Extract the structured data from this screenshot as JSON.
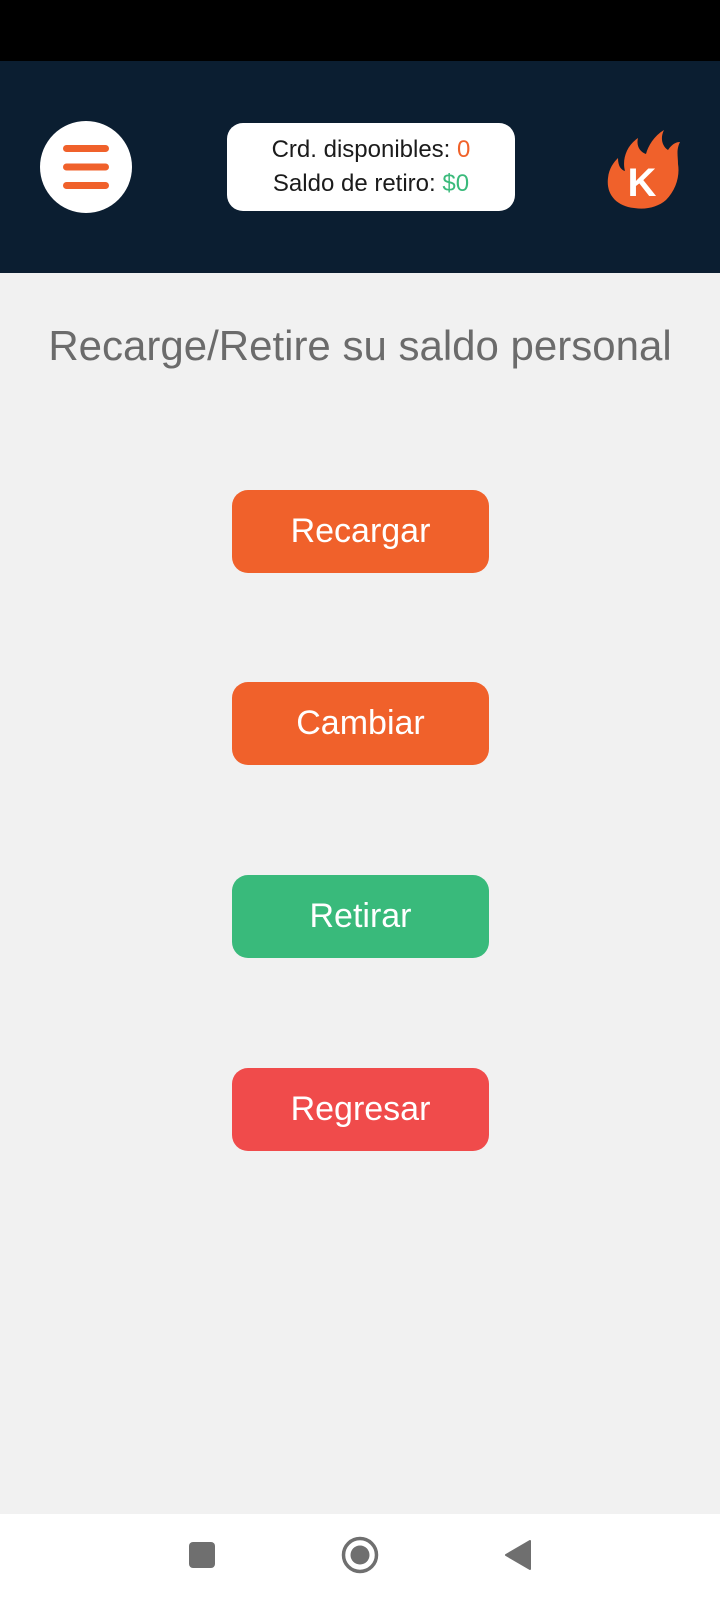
{
  "header": {
    "credits_label": "Crd. disponibles:",
    "credits_value": "0",
    "withdraw_label": "Saldo de retiro:",
    "withdraw_value": "$0",
    "logo_letter": "K"
  },
  "page": {
    "title": "Recarge/Retire su saldo personal"
  },
  "actions": {
    "recargar": "Recargar",
    "cambiar": "Cambiar",
    "retirar": "Retirar",
    "regresar": "Regresar"
  },
  "icons": {
    "menu": "hamburger-menu-icon",
    "logo": "flame-k-logo",
    "recents": "square-recents-icon",
    "home": "circle-home-icon",
    "back": "triangle-back-icon"
  },
  "colors": {
    "header_bg": "#0b1e31",
    "accent_orange": "#f0612b",
    "accent_green": "#39ba7b",
    "accent_red": "#f04b4b",
    "page_bg": "#f1f1f1"
  }
}
